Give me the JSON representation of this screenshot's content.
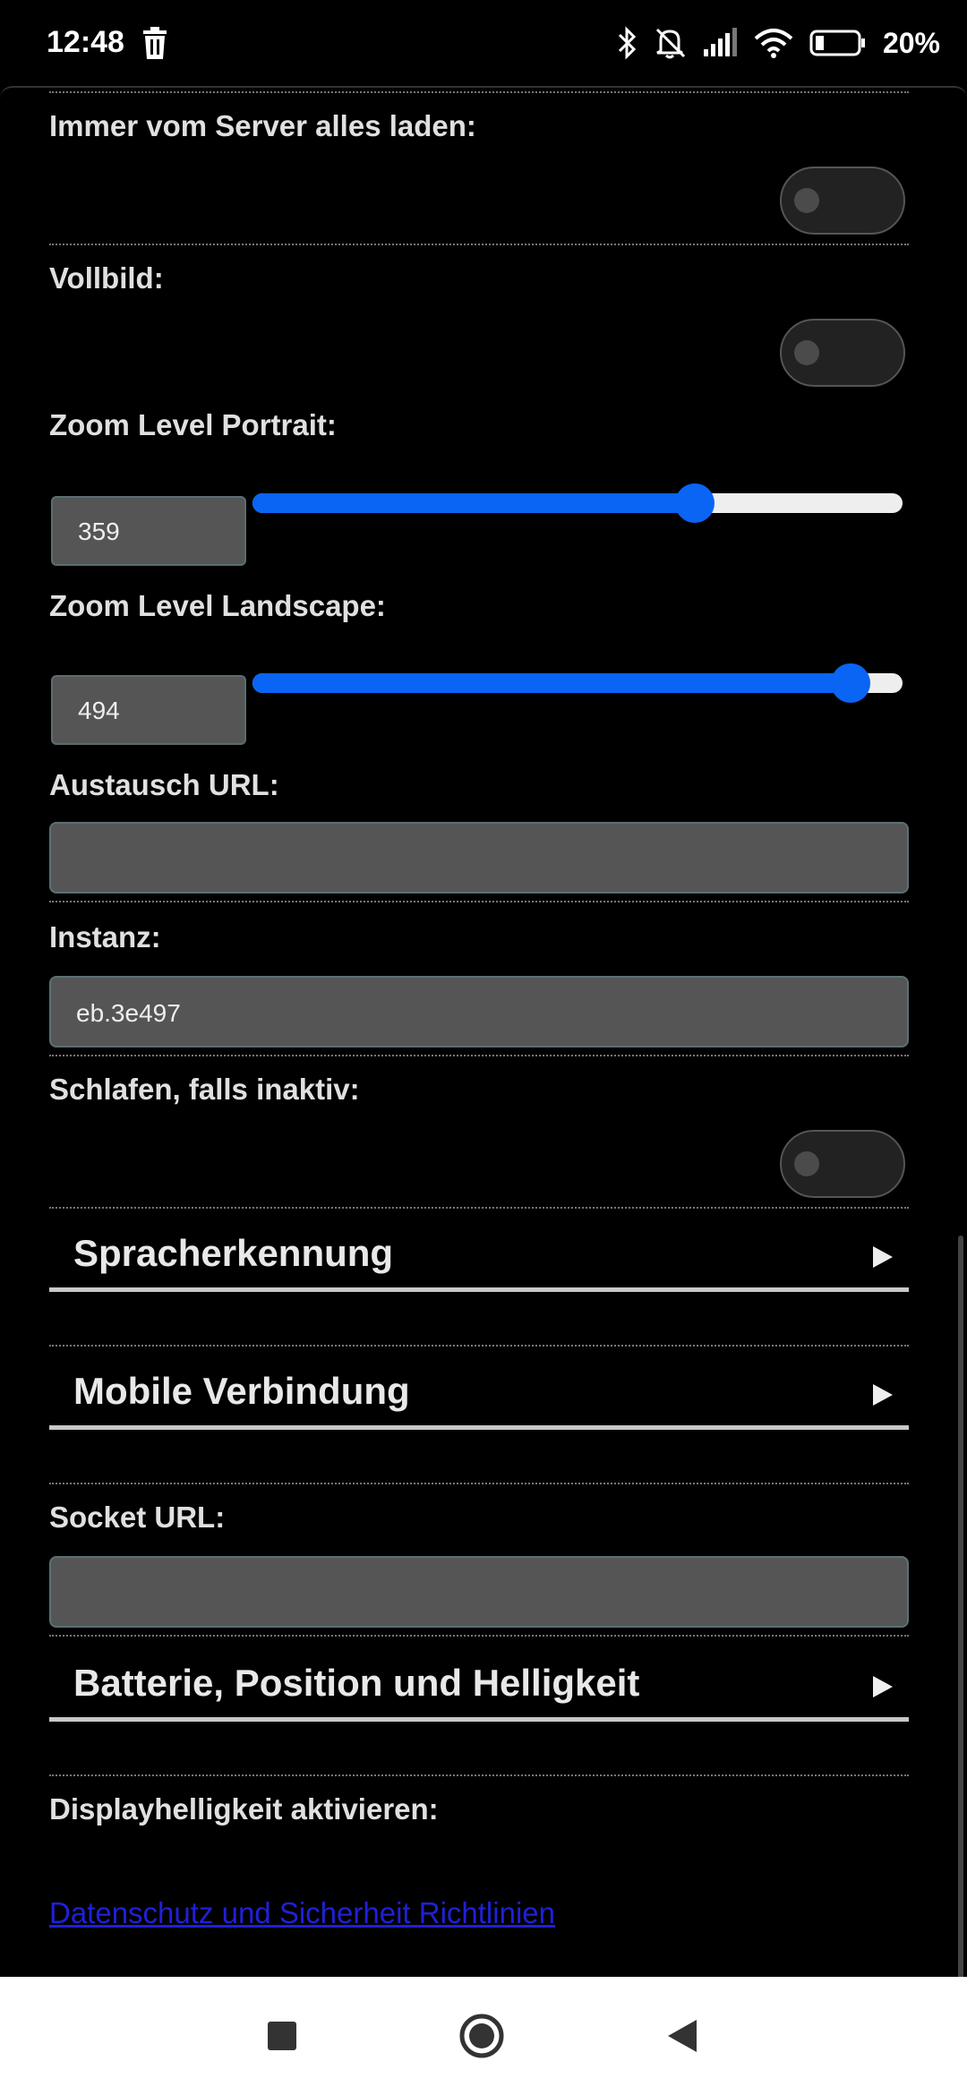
{
  "status_bar": {
    "time": "12:48",
    "battery_percent": "20%",
    "icons": [
      "trash-icon",
      "bluetooth-icon",
      "bell-off-icon",
      "signal-icon",
      "wifi-icon",
      "battery-icon"
    ]
  },
  "settings": {
    "load_all_label": "Immer vom Server alles laden:",
    "load_all_on": false,
    "fullscreen_label": "Vollbild:",
    "fullscreen_on": false,
    "zoom_portrait_label": "Zoom Level Portrait:",
    "zoom_portrait_value": "359",
    "zoom_portrait_level": 0.68,
    "zoom_landscape_label": "Zoom Level Landscape:",
    "zoom_landscape_value": "494",
    "zoom_landscape_level": 0.92,
    "exchange_url_label": "Austausch URL:",
    "exchange_url_value": "",
    "instance_label": "Instanz:",
    "instance_value": "eb.3e497",
    "sleep_label": "Schlafen, falls inaktiv:",
    "sleep_on": false,
    "section_speech": "Spracherkennung",
    "section_mobile": "Mobile Verbindung",
    "socket_url_label": "Socket URL:",
    "socket_url_value": "",
    "section_battery": "Batterie, Position und Helligkeit",
    "brightness_label": "Displayhelligkeit aktivieren:",
    "privacy_link": "Datenschutz und Sicherheit Richtlinien"
  },
  "colors": {
    "accent": "#0a64f4",
    "link": "#2020d8",
    "background": "#000000"
  }
}
